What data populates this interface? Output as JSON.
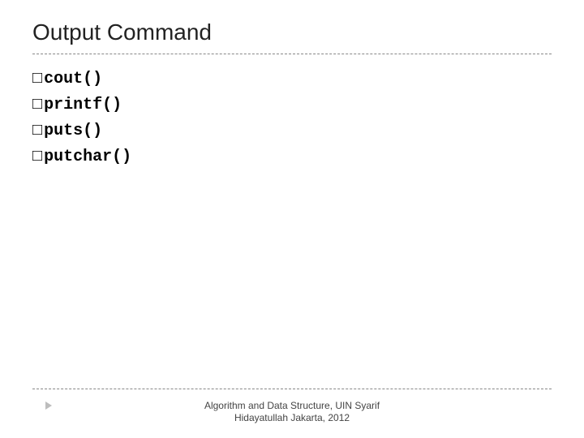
{
  "title": "Output Command",
  "items": [
    "cout()",
    "printf()",
    "puts()",
    "putchar()"
  ],
  "footer_line1": "Algorithm and Data Structure, UIN Syarif",
  "footer_line2": "Hidayatullah Jakarta, 2012"
}
